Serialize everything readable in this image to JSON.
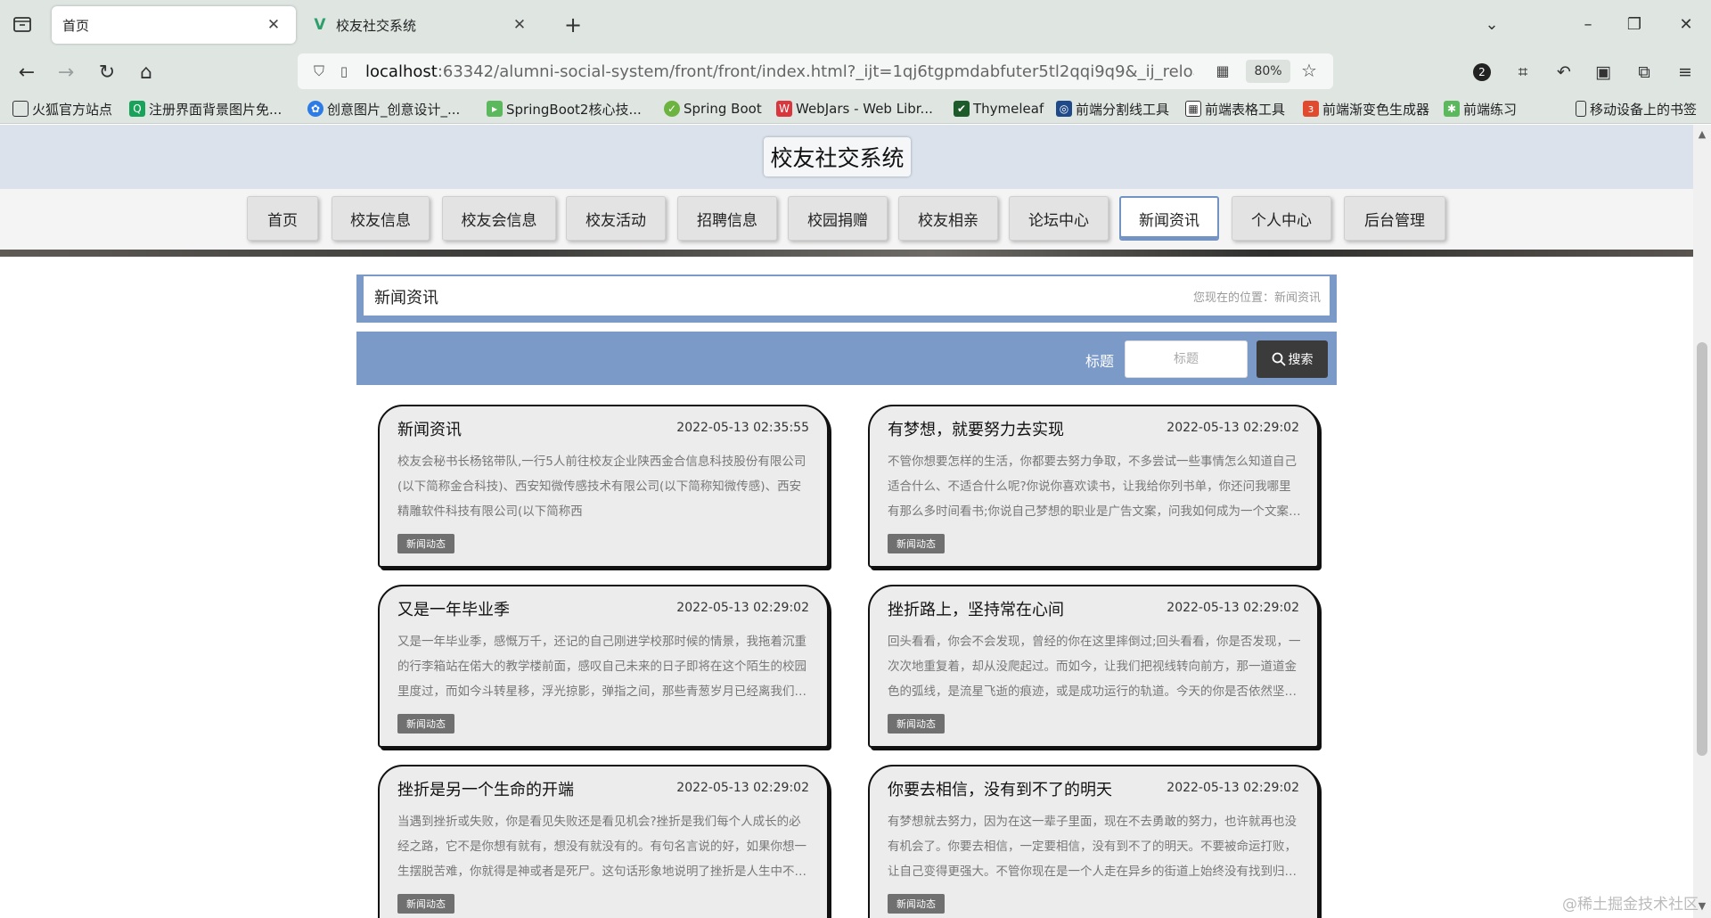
{
  "browser": {
    "tabs": [
      {
        "title": "首页",
        "active": true
      },
      {
        "title": "校友社交系统",
        "active": false
      }
    ],
    "url": {
      "host": "localhost",
      "rest": ":63342/alumni-social-system/front/front/index.html?_ijt=1qj6tgpmdabfuter5tl2qqi9q9&_ij_reload=RELOAD_ON_SAVE"
    },
    "zoom": "80%",
    "extension_badge": "2",
    "bookmarks": [
      "火狐官方站点",
      "注册界面背景图片免...",
      "创意图片_创意设计_...",
      "SpringBoot2核心技...",
      "Spring Boot",
      "WebJars - Web Libr...",
      "Thymeleaf",
      "前端分割线工具",
      "前端表格工具",
      "前端渐变色生成器",
      "前端练习"
    ],
    "mobile_bookmarks": "移动设备上的书签"
  },
  "site": {
    "title": "校友社交系统",
    "menu": [
      "首页",
      "校友信息",
      "校友会信息",
      "校友活动",
      "招聘信息",
      "校园捐赠",
      "校友相亲",
      "论坛中心",
      "新闻资讯",
      "个人中心",
      "后台管理"
    ],
    "active_menu": "新闻资讯"
  },
  "breadcrumb": {
    "title": "新闻资讯",
    "path": "您现在的位置：新闻资讯"
  },
  "search": {
    "label": "标题",
    "placeholder": "标题",
    "button": "搜索"
  },
  "news": [
    {
      "title": "新闻资讯",
      "time": "2022-05-13 02:35:55",
      "summary": "校友会秘书长杨铭带队,一行5人前往校友企业陕西金合信息科技股份有限公司(以下简称金合科技)、西安知微传感技术有限公司(以下简称知微传感)、西安精雕软件科技有限公司(以下简称西",
      "tag": "新闻动态"
    },
    {
      "title": "有梦想，就要努力去实现",
      "time": "2022-05-13 02:29:02",
      "summary": "不管你想要怎样的生活，你都要去努力争取，不多尝试一些事情怎么知道自己适合什么、不适合什么呢?你说你喜欢读书，让我给你列书单，你还问我哪里有那么多时间看书;你说自己梦想的职业是广告文案，问我如何成为一个文案，应该具备哪些素质。",
      "tag": "新闻动态"
    },
    {
      "title": "又是一年毕业季",
      "time": "2022-05-13 02:29:02",
      "summary": "又是一年毕业季，感慨万千，还记的自己刚进学校那时候的情景，我拖着沉重的行李箱站在偌大的教学楼前面，感叹自己未来的日子即将在这个陌生的校园里度过，而如今斗转星移，浮光掠影，弹指之间，那些青葱岁月已经离我们远去。",
      "tag": "新闻动态"
    },
    {
      "title": "挫折路上，坚持常在心间",
      "time": "2022-05-13 02:29:02",
      "summary": "回头看看，你会不会发现，曾经的你在这里摔倒过;回头看看，你是否发现，一次次地重复着，却从没爬起过。而如今，让我们把视线转向前方，那一道道金色的弧线，是流星飞逝的痕迹，或是成功运行的轨道。今天的你是否依然坚持着心中的梦想。",
      "tag": "新闻动态"
    },
    {
      "title": "挫折是另一个生命的开端",
      "time": "2022-05-13 02:29:02",
      "summary": "当遇到挫折或失败，你是看见失败还是看见机会?挫折是我们每个人成长的必经之路，它不是你想有就有，想没有就没有的。有句名言说的好，如果你想一生摆脱苦难，你就得是神或者是死尸。这句话形象地说明了挫折是人生中不可避免的。",
      "tag": "新闻动态"
    },
    {
      "title": "你要去相信，没有到不了的明天",
      "time": "2022-05-13 02:29:02",
      "summary": "有梦想就去努力，因为在这一辈子里面，现在不去勇敢的努力，也许就再也没有机会了。你要去相信，一定要相信，没有到不了的明天。不要被命运打败，让自己变得更强大。不管你现在是一个人走在异乡的街道上始终没有找到归属感。",
      "tag": "新闻动态"
    }
  ],
  "watermark": "@稀土掘金技术社区"
}
